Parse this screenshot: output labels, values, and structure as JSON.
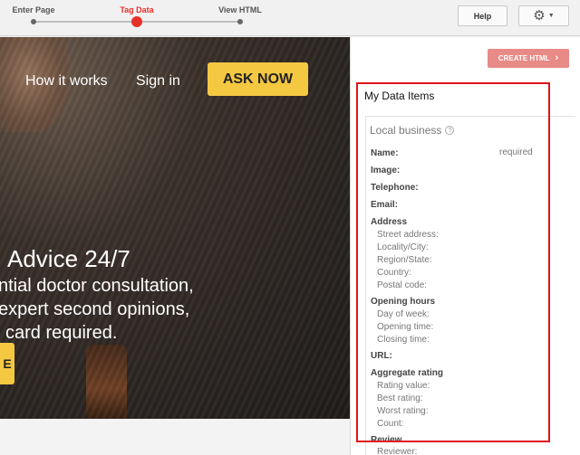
{
  "stepper": {
    "steps": [
      {
        "label": "Enter Page",
        "active": false
      },
      {
        "label": "Tag Data",
        "active": true
      },
      {
        "label": "View HTML",
        "active": false
      }
    ]
  },
  "toolbar": {
    "help_label": "Help",
    "settings_icon": "gear-icon"
  },
  "hero": {
    "nav_how": "How it works",
    "nav_signin": "Sign in",
    "ask_label": "ASK NOW",
    "headline": "Advice 24/7",
    "line1": "ntial doctor consultation,",
    "line2": "expert second opinions,",
    "line3": "card required.",
    "cta_fragment": "E"
  },
  "panel": {
    "create_label": "CREATE HTML",
    "title": "My Data Items",
    "section_title": "Local business",
    "required_label": "required",
    "fields": [
      {
        "label": "Name:",
        "kind": "main"
      },
      {
        "label": "Image:",
        "kind": "main"
      },
      {
        "label": "Telephone:",
        "kind": "main"
      },
      {
        "label": "Email:",
        "kind": "main"
      },
      {
        "label": "Address",
        "kind": "main"
      },
      {
        "label": "Street address:",
        "kind": "sub"
      },
      {
        "label": "Locality/City:",
        "kind": "sub"
      },
      {
        "label": "Region/State:",
        "kind": "sub"
      },
      {
        "label": "Country:",
        "kind": "sub"
      },
      {
        "label": "Postal code:",
        "kind": "sub"
      },
      {
        "label": "Opening hours",
        "kind": "main"
      },
      {
        "label": "Day of week:",
        "kind": "sub"
      },
      {
        "label": "Opening time:",
        "kind": "sub"
      },
      {
        "label": "Closing time:",
        "kind": "sub"
      },
      {
        "label": "URL:",
        "kind": "main"
      },
      {
        "label": "Aggregate rating",
        "kind": "main"
      },
      {
        "label": "Rating value:",
        "kind": "sub"
      },
      {
        "label": "Best rating:",
        "kind": "sub"
      },
      {
        "label": "Worst rating:",
        "kind": "sub"
      },
      {
        "label": "Count:",
        "kind": "sub"
      },
      {
        "label": "Review",
        "kind": "main"
      },
      {
        "label": "Reviewer:",
        "kind": "sub"
      }
    ]
  },
  "colors": {
    "accent_red": "#e8302a",
    "ask_yellow": "#f5c842",
    "create_button": "#e88a86",
    "highlight_frame": "#e0141c"
  }
}
